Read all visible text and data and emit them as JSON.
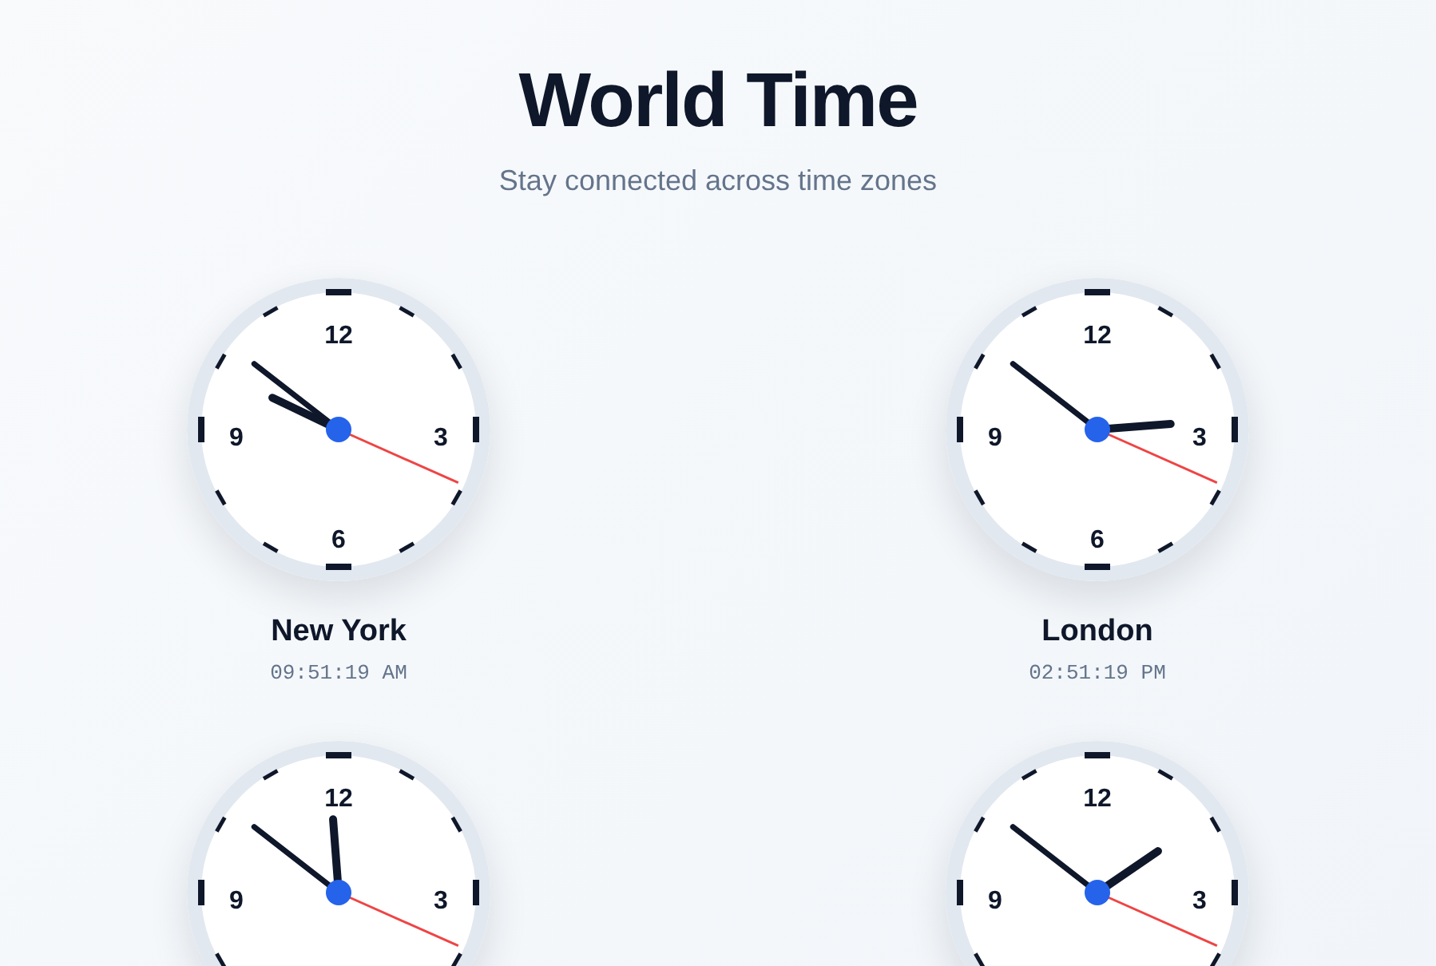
{
  "header": {
    "title": "World Time",
    "subtitle": "Stay connected across time zones"
  },
  "clocks": [
    {
      "name": "New York",
      "time": "09:51:19 AM",
      "numerals": [
        {
          "text": "12",
          "kind": "top"
        },
        {
          "text": "3",
          "kind": "right"
        },
        {
          "text": "6",
          "kind": "bottom"
        },
        {
          "text": "9",
          "kind": "left"
        }
      ]
    },
    {
      "name": "London",
      "time": "02:51:19 PM",
      "numerals": [
        {
          "text": "12",
          "kind": "top"
        },
        {
          "text": "3",
          "kind": "right"
        },
        {
          "text": "6",
          "kind": "bottom"
        },
        {
          "text": "9",
          "kind": "left"
        }
      ]
    },
    {
      "numerals": [
        {
          "text": "12",
          "kind": "top"
        },
        {
          "text": "3",
          "kind": "right"
        },
        {
          "text": "9",
          "kind": "left"
        }
      ]
    },
    {
      "numerals": [
        {
          "text": "12",
          "kind": "top"
        },
        {
          "text": "3",
          "kind": "right"
        },
        {
          "text": "9",
          "kind": "left"
        }
      ]
    }
  ]
}
